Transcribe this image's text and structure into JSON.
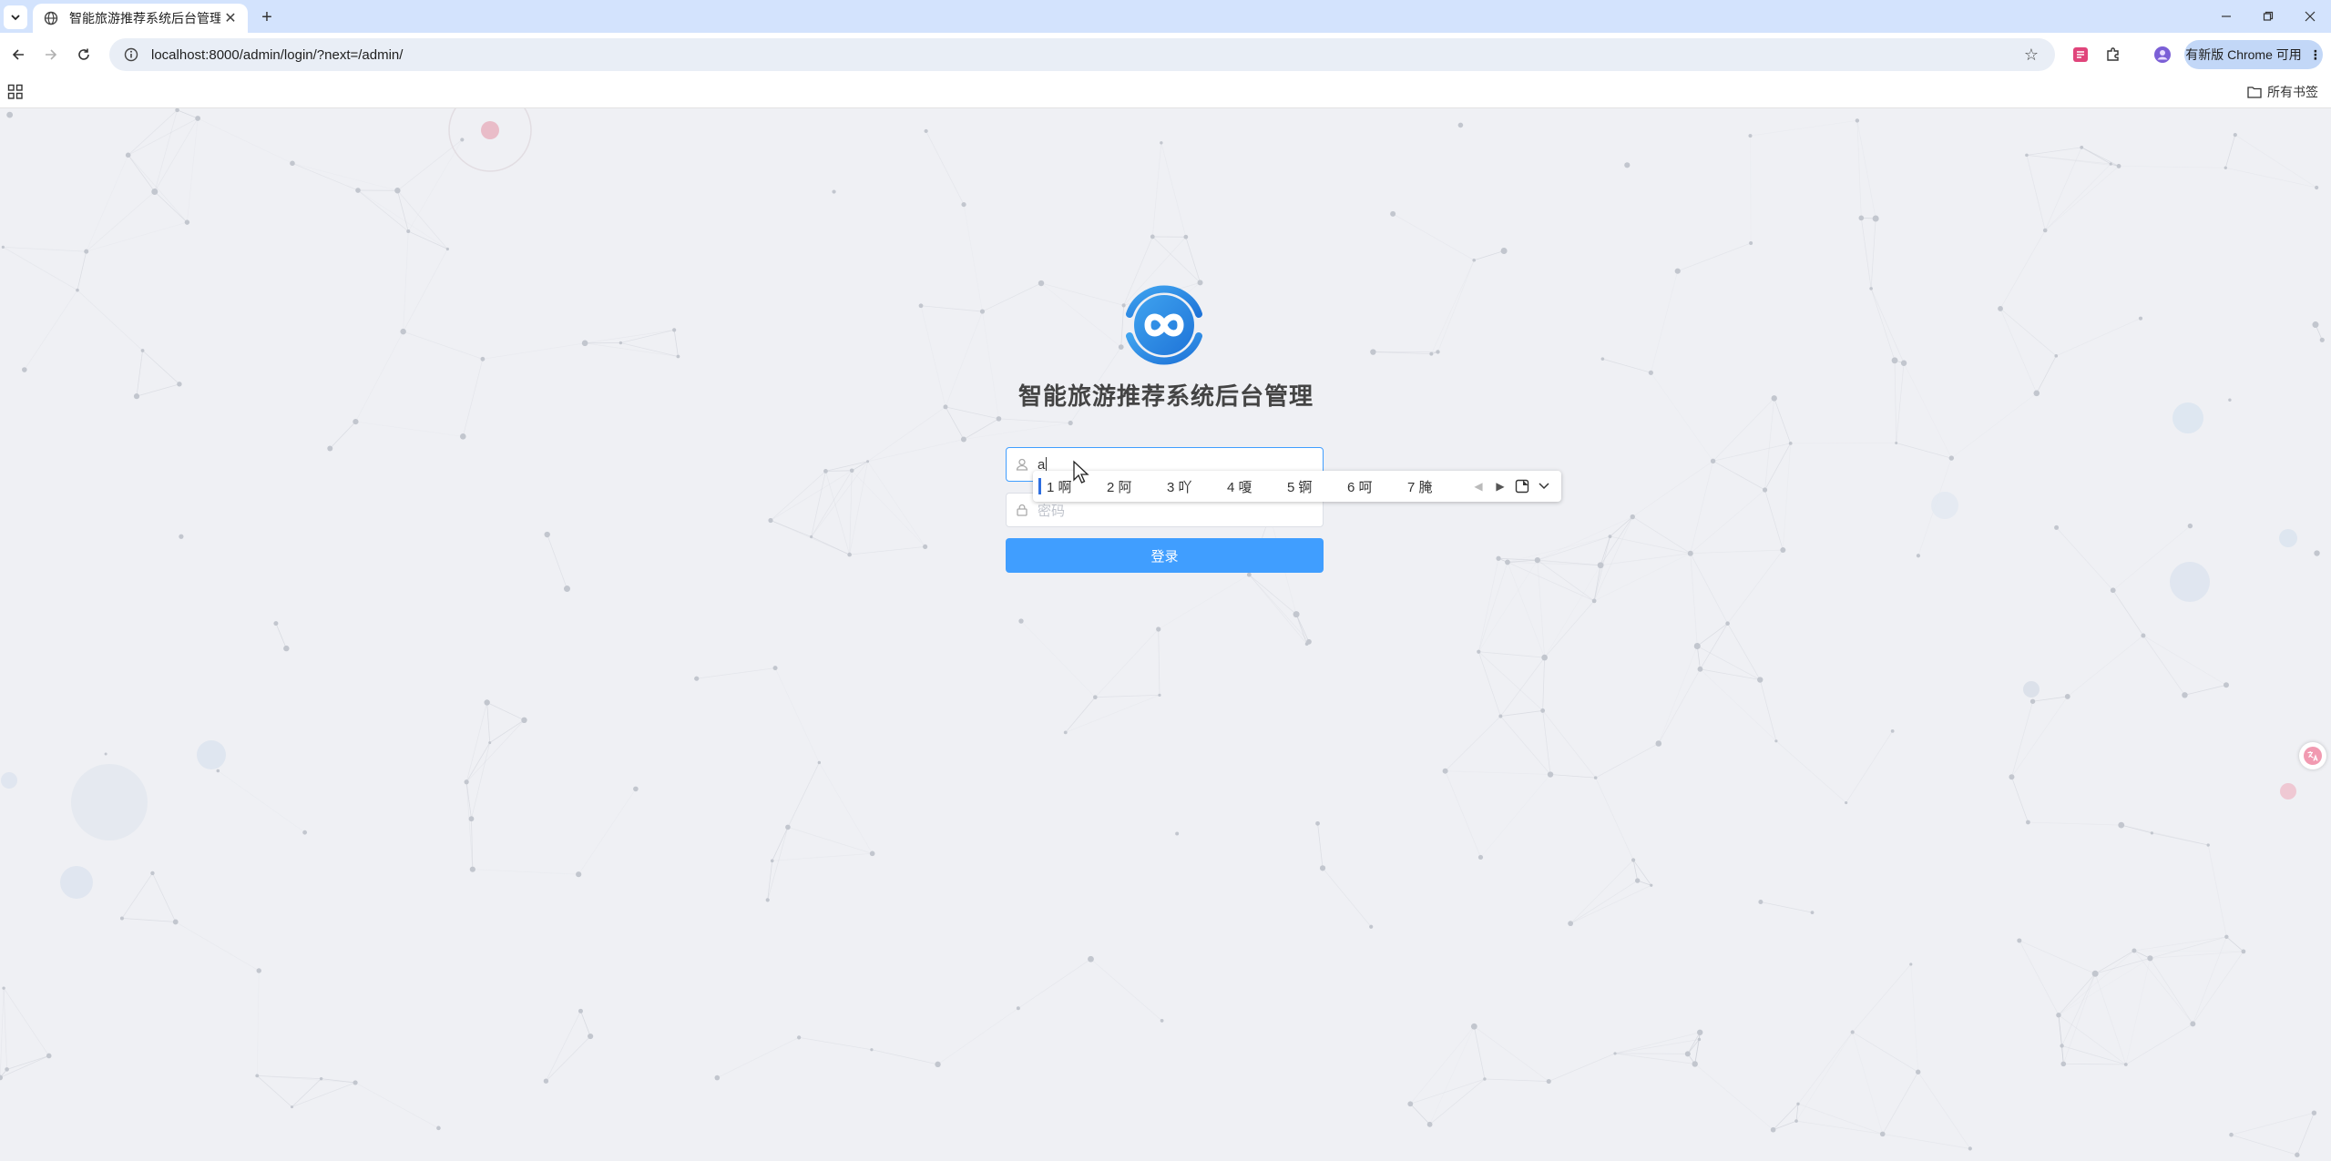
{
  "browser": {
    "tab_title": "智能旅游推荐系统后台管理-登",
    "url": "localhost:8000/admin/login/?next=/admin/",
    "update_label": "有新版 Chrome 可用",
    "bookmarks_folder": "所有书签",
    "new_tab_symbol": "+",
    "close_symbol": "✕"
  },
  "login": {
    "title": "智能旅游推荐系统后台管理",
    "username_value": "a",
    "password_placeholder": "密码",
    "submit_label": "登录"
  },
  "ime": {
    "candidates": [
      "1 啊",
      "2 阿",
      "3 吖",
      "4 嗄",
      "5 锕",
      "6 呵",
      "7 腌"
    ]
  },
  "colors": {
    "primary": "#409eff",
    "tabstrip": "#d3e3fd",
    "page_bg": "#eff0f4"
  }
}
